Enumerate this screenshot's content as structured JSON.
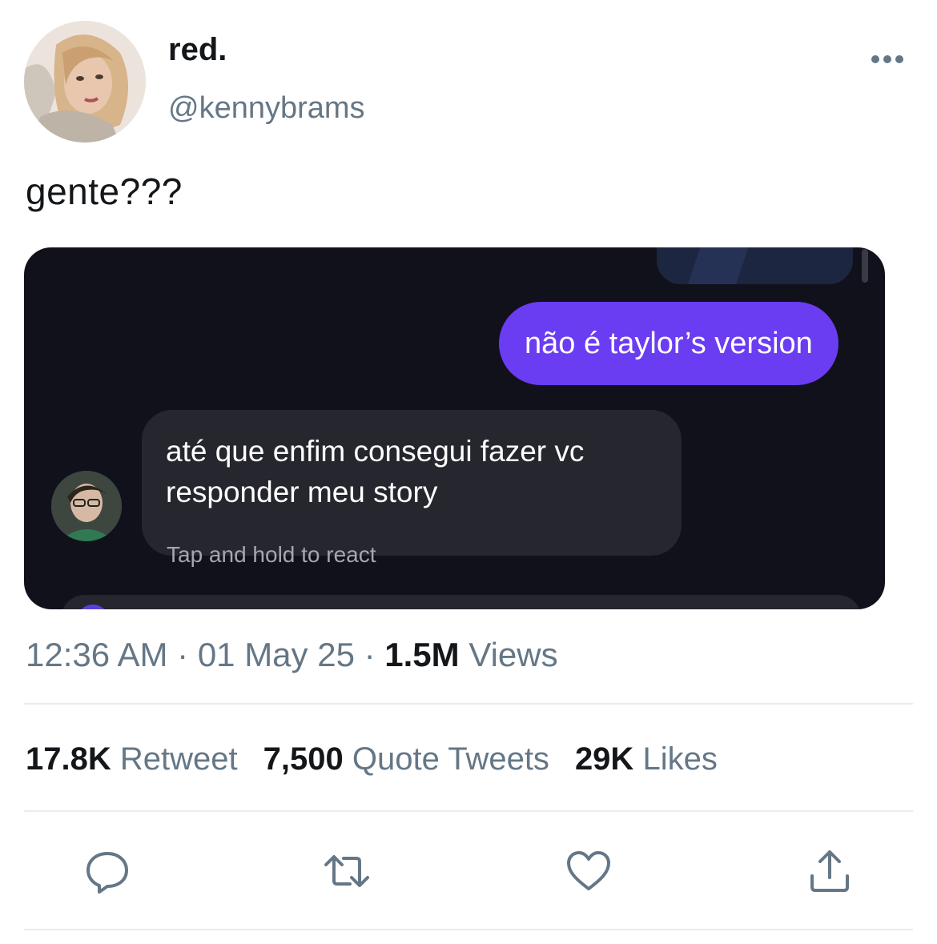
{
  "tweet": {
    "display_name": "red.",
    "handle": "@kennybrams",
    "text": "gente???",
    "time": "12:36 AM",
    "separator": "·",
    "date": "01 May 25",
    "views_count": "1.5M",
    "views_label": "Views"
  },
  "media": {
    "outgoing_message": "não é taylor’s version",
    "incoming_message_line1": "até que enfim consegui fazer vc",
    "incoming_message_line2": "responder meu story",
    "tap_hint": "Tap and hold to react",
    "outgoing_color": "#6a3df2",
    "background_color": "#11111b"
  },
  "stats": {
    "retweets_count": "17.8K",
    "retweets_label": "Retweet",
    "quotes_count": "7,500",
    "quotes_label": "Quote Tweets",
    "likes_count": "29K",
    "likes_label": "Likes"
  },
  "actions": {
    "icons": [
      "reply-icon",
      "retweet-icon",
      "like-icon",
      "share-icon"
    ],
    "color": "#657786"
  }
}
